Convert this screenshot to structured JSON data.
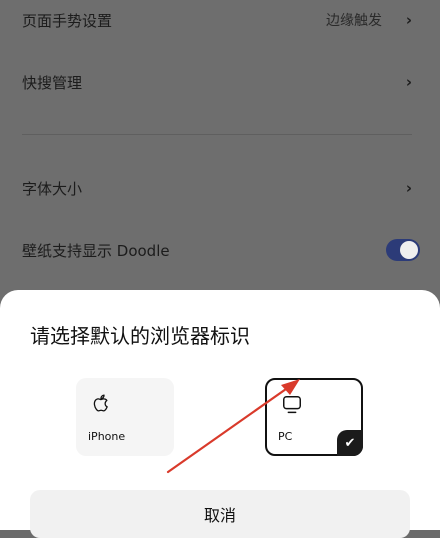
{
  "settings": {
    "items": [
      {
        "label": "页面手势设置",
        "value": "边缘触发",
        "chevron": "›"
      },
      {
        "label": "快搜管理",
        "chevron": "›"
      },
      {
        "label": "字体大小",
        "chevron": "›"
      },
      {
        "label": "壁纸支持显示 Doodle",
        "toggle": true
      }
    ]
  },
  "sheet": {
    "title": "请选择默认的浏览器标识",
    "options": [
      {
        "name": "iPhone",
        "icon": "apple-icon",
        "selected": false
      },
      {
        "name": "PC",
        "icon": "monitor-icon",
        "selected": true
      }
    ],
    "check_glyph": "✔",
    "cancel_label": "取消"
  },
  "colors": {
    "overlay": "#6e6e6e",
    "toggle_on": "#2c3b78",
    "arrow": "#d93a2b"
  }
}
